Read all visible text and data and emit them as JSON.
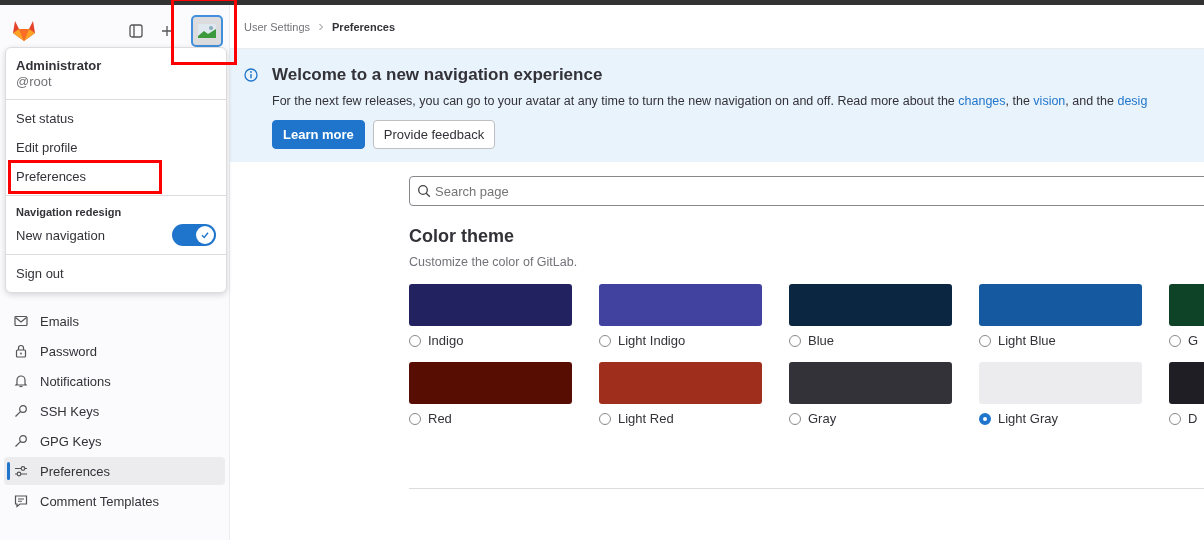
{
  "header": {
    "avatar": {
      "annotated": true
    },
    "breadcrumbs": [
      "User Settings",
      "Preferences"
    ]
  },
  "user_menu": {
    "name": "Administrator",
    "username": "@root",
    "items": [
      {
        "label": "Set status",
        "annotated": false
      },
      {
        "label": "Edit profile",
        "annotated": false
      },
      {
        "label": "Preferences",
        "annotated": true
      }
    ],
    "section_title": "Navigation redesign",
    "toggle": {
      "label": "New navigation",
      "on": true
    },
    "sign_out": "Sign out"
  },
  "sidebar": {
    "items": [
      {
        "label": "Emails",
        "kind": "mail",
        "selected": false
      },
      {
        "label": "Password",
        "kind": "lock",
        "selected": false
      },
      {
        "label": "Notifications",
        "kind": "bell",
        "selected": false
      },
      {
        "label": "SSH Keys",
        "kind": "key",
        "selected": false
      },
      {
        "label": "GPG Keys",
        "kind": "key",
        "selected": false
      },
      {
        "label": "Preferences",
        "kind": "sliders",
        "selected": true
      },
      {
        "label": "Comment Templates",
        "kind": "comment",
        "selected": false
      }
    ]
  },
  "banner": {
    "title": "Welcome to a new navigation experience",
    "text": [
      {
        "kind": "text",
        "text": "For the next few releases, you can go to your avatar at any time to turn the new navigation on and off. Read more about the "
      },
      {
        "kind": "link",
        "text": "changes"
      },
      {
        "kind": "text",
        "text": ", the "
      },
      {
        "kind": "link",
        "text": "vision"
      },
      {
        "kind": "text",
        "text": ", and the "
      },
      {
        "kind": "link",
        "text": "desig"
      }
    ],
    "buttons": [
      {
        "label": "Learn more",
        "kind": "primary"
      },
      {
        "label": "Provide feedback",
        "kind": "default"
      }
    ]
  },
  "search": {
    "placeholder": "Search page"
  },
  "color_theme": {
    "title": "Color theme",
    "description": "Customize the color of GitLab.",
    "themes": [
      {
        "label": "Indigo",
        "color": "#222261",
        "selected": false
      },
      {
        "label": "Light Indigo",
        "color": "#41419f",
        "selected": false
      },
      {
        "label": "Blue",
        "color": "#0b2640",
        "selected": false
      },
      {
        "label": "Light Blue",
        "color": "#155aa0",
        "selected": false
      },
      {
        "label": "G",
        "color": "#0e4328",
        "selected": false
      },
      {
        "label": "Red",
        "color": "#580d02",
        "selected": false
      },
      {
        "label": "Light Red",
        "color": "#a02e1c",
        "selected": false
      },
      {
        "label": "Gray",
        "color": "#333238",
        "selected": false
      },
      {
        "label": "Light Gray",
        "color": "#ececef",
        "selected": true
      },
      {
        "label": "D",
        "color": "#1f1e24",
        "selected": false
      }
    ]
  }
}
